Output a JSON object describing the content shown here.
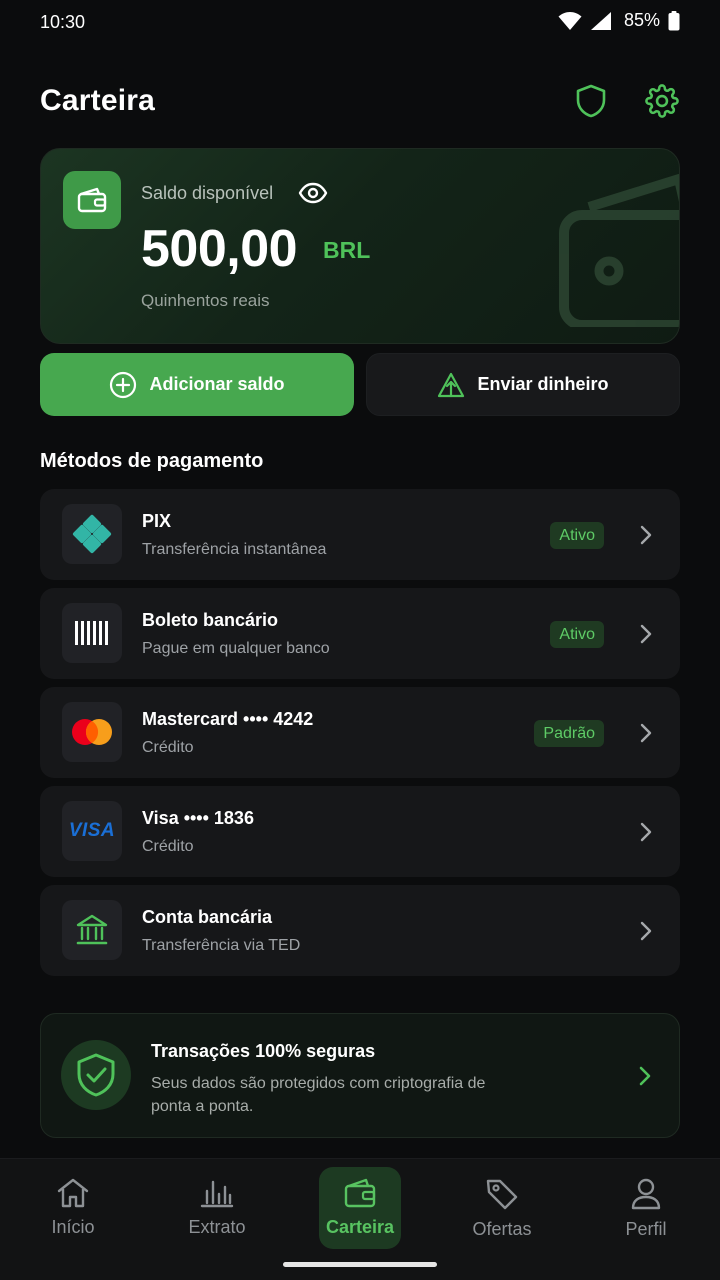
{
  "status_bar": {
    "time": "10:30",
    "battery": "85%"
  },
  "header": {
    "title": "Carteira",
    "icons": [
      "shield-icon",
      "gear-icon"
    ]
  },
  "balance": {
    "label": "Saldo disponível",
    "amount": "500,00",
    "currency": "BRL",
    "amount_words": "Quinhentos reais"
  },
  "actions": {
    "add_label": "Adicionar saldo",
    "send_label": "Enviar dinheiro"
  },
  "payment_methods": {
    "title": "Métodos de pagamento",
    "items": [
      {
        "name": "PIX",
        "description": "Transferência instantânea",
        "badge": "Ativo",
        "icon": "pix-icon"
      },
      {
        "name": "Boleto bancário",
        "description": "Pague em qualquer banco",
        "badge": "Ativo",
        "icon": "barcode-icon"
      },
      {
        "name": "Mastercard •••• 4242",
        "description": "Crédito",
        "badge": "Padrão",
        "icon": "mastercard-icon"
      },
      {
        "name": "Visa •••• 1836",
        "description": "Crédito",
        "badge": "",
        "icon": "visa-icon",
        "icon_text": "VISA"
      },
      {
        "name": "Conta bancária",
        "description": "Transferência via TED",
        "badge": "",
        "icon": "bank-icon"
      }
    ]
  },
  "security": {
    "title": "Transações 100% seguras",
    "description": "Seus dados são protegidos com criptografia de ponta a ponta."
  },
  "bottom_nav": {
    "items": [
      {
        "label": "Início",
        "icon": "home-icon",
        "active": false
      },
      {
        "label": "Extrato",
        "icon": "bar-chart-icon",
        "active": false
      },
      {
        "label": "Carteira",
        "icon": "wallet-icon",
        "active": true
      },
      {
        "label": "Ofertas",
        "icon": "tag-icon",
        "active": false
      },
      {
        "label": "Perfil",
        "icon": "user-icon",
        "active": false
      }
    ]
  },
  "colors": {
    "accent": "#47a84f",
    "accent_text": "#4fc25a",
    "background": "#0b0c0d",
    "card": "#161719"
  }
}
